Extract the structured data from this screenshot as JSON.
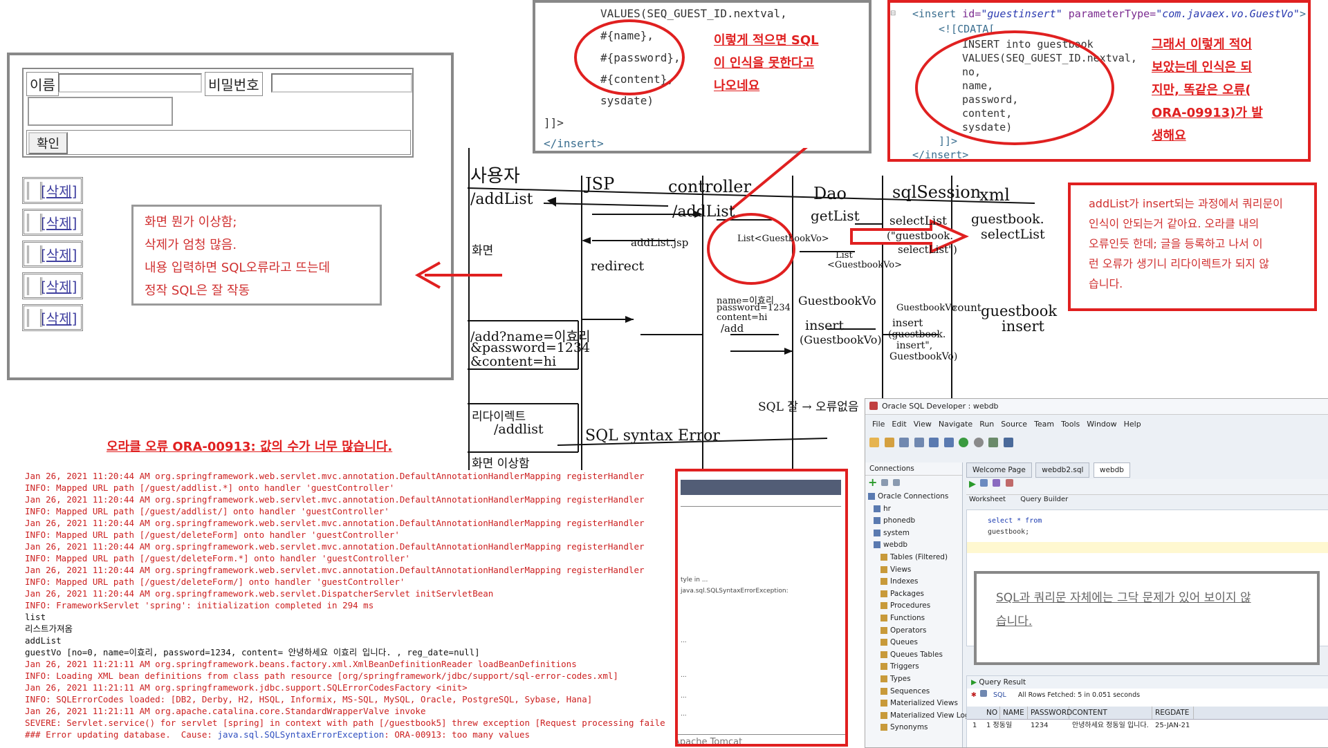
{
  "form": {
    "name_label": "이름",
    "password_label": "비밀번호",
    "confirm_label": "확인",
    "delete_label": "[삭제]"
  },
  "notes": {
    "screen_note": [
      "화면 뭔가 이상함;",
      "삭제가 엄청 많음.",
      "내용 입력하면 SQL오류라고 뜨는데",
      "정작 SQL은 잘 작동"
    ],
    "sql_note": [
      "이렇게 적으면 SQL",
      "이 인식을 못한다고",
      "나오네요"
    ],
    "sql_note2": [
      "그래서 이렇게 적어",
      "보았는데 인식은 되",
      "지만, 똑같은 오류(",
      "ORA-09913)가 발",
      "생해요"
    ],
    "addlist_note": [
      "addList가 insert되는 과정에서 쿼리문이",
      "인식이 안되는거 같아요. 오라클 내의",
      "오류인듯 한데; 글을 등록하고 나서 이",
      "런 오류가 생기니 리다이렉트가 되지 않",
      "습니다."
    ],
    "oracle_error_title": "오라클 오류 ORA-00913: 값의 수가 너무 많습니다.",
    "query_ok_note": [
      "SQL과 쿼리문 자체에는 그닥 문제가 있어 보이지 않",
      "습니다."
    ]
  },
  "code1": {
    "lines": [
      "VALUES(SEQ_GUEST_ID.nextval,",
      "#{name},",
      "#{password},",
      "#{content},",
      "sysdate)",
      "]]>",
      "</insert>"
    ]
  },
  "code2": {
    "insert_open": "<insert",
    "id_attr": "id=",
    "id_val": "\"guestinsert\"",
    "param_attr": "parameterType=",
    "param_val": "\"com.javaex.vo.GuestVo\"",
    "insert_close_bracket": ">",
    "cdata": "<![CDATA[",
    "body": [
      "INSERT into guestbook",
      "VALUES(SEQ_GUEST_ID.nextval,",
      "no,",
      "name,",
      "password,",
      "content,",
      "sysdate)"
    ],
    "cdata_end": "]]>",
    "insert_end": "</insert>"
  },
  "sketch": {
    "actors": [
      "사용자",
      "JSP",
      "controller",
      "Dao",
      "sqlSession",
      "xml"
    ],
    "labels": {
      "addlist1": "/addList",
      "addlist2": "/addList",
      "getlist": "getList",
      "selectlist": "selectList",
      "guestbook_select": "guestbook.",
      "guestbook_select2": "selectList",
      "selectlist_q1": "(\"guestbook.",
      "selectlist_q2": "selectList\")",
      "list_vo": "List<GuestbookVo>",
      "list_vo2": "List",
      "list_vo3": "<GuestbookVo>",
      "addlist_jsp": "addList.jsp",
      "screen": "화면",
      "redirect": "redirect",
      "params": "name=이효리",
      "params2": "password=1234",
      "params3": "content=hi",
      "params4": "/add",
      "guestbookvo": "GuestbookVo",
      "insert": "insert",
      "insert_vo": "(GuestbookVo)",
      "insert2": "insert",
      "insert3": "(guestbook.",
      "insert4": "insert\",",
      "insert5": "GuestbookVo)",
      "guestbookvo2": "GuestbookVo",
      "count": "count",
      "guestbook_insert": "guestbook",
      "guestbook_insert2": "insert",
      "add_url1": "/add?name=이효리",
      "add_url2": "&password=1234",
      "add_url3": "&content=hi",
      "redirect_ko": "리다이렉트",
      "addlist3": "/addlist",
      "syntax": "SQL syntax Error",
      "sql_ok": "SQL 잘 → 오류없음",
      "screen_weird": "화면 이상함"
    }
  },
  "log": {
    "lines": [
      {
        "t": "Jan 26, 2021 11:20:44 AM org.springframework.web.servlet.mvc.annotation.DefaultAnnotationHandlerMapping registerHandler",
        "c": "r"
      },
      {
        "t": "INFO: Mapped URL path [/guest/addlist.*] onto handler 'guestController'",
        "c": "r"
      },
      {
        "t": "Jan 26, 2021 11:20:44 AM org.springframework.web.servlet.mvc.annotation.DefaultAnnotationHandlerMapping registerHandler",
        "c": "r"
      },
      {
        "t": "INFO: Mapped URL path [/guest/addlist/] onto handler 'guestController'",
        "c": "r"
      },
      {
        "t": "Jan 26, 2021 11:20:44 AM org.springframework.web.servlet.mvc.annotation.DefaultAnnotationHandlerMapping registerHandler",
        "c": "r"
      },
      {
        "t": "INFO: Mapped URL path [/guest/deleteForm] onto handler 'guestController'",
        "c": "r"
      },
      {
        "t": "Jan 26, 2021 11:20:44 AM org.springframework.web.servlet.mvc.annotation.DefaultAnnotationHandlerMapping registerHandler",
        "c": "r"
      },
      {
        "t": "INFO: Mapped URL path [/guest/deleteForm.*] onto handler 'guestController'",
        "c": "r"
      },
      {
        "t": "Jan 26, 2021 11:20:44 AM org.springframework.web.servlet.mvc.annotation.DefaultAnnotationHandlerMapping registerHandler",
        "c": "r"
      },
      {
        "t": "INFO: Mapped URL path [/guest/deleteForm/] onto handler 'guestController'",
        "c": "r"
      },
      {
        "t": "Jan 26, 2021 11:20:44 AM org.springframework.web.servlet.DispatcherServlet initServletBean",
        "c": "r"
      },
      {
        "t": "INFO: FrameworkServlet 'spring': initialization completed in 294 ms",
        "c": "r"
      },
      {
        "t": "list",
        "c": "k"
      },
      {
        "t": "리스트가져옴",
        "c": "k"
      },
      {
        "t": "addList",
        "c": "k"
      },
      {
        "t": "guestVo [no=0, name=이효리, password=1234, content= 안녕하세요 이효리 입니다. , reg_date=null]",
        "c": "k"
      },
      {
        "t": "Jan 26, 2021 11:21:11 AM org.springframework.beans.factory.xml.XmlBeanDefinitionReader loadBeanDefinitions",
        "c": "r"
      },
      {
        "t": "INFO: Loading XML bean definitions from class path resource [org/springframework/jdbc/support/sql-error-codes.xml]",
        "c": "r"
      },
      {
        "t": "Jan 26, 2021 11:21:11 AM org.springframework.jdbc.support.SQLErrorCodesFactory <init>",
        "c": "r"
      },
      {
        "t": "INFO: SQLErrorCodes loaded: [DB2, Derby, H2, HSQL, Informix, MS-SQL, MySQL, Oracle, PostgreSQL, Sybase, Hana]",
        "c": "r"
      },
      {
        "t": "Jan 26, 2021 11:21:11 AM org.apache.catalina.core.StandardWrapperValve invoke",
        "c": "r"
      },
      {
        "t": "SEVERE: Servlet.service() for servlet [spring] in context with path [/guestbook5] threw exception [Request processing faile",
        "c": "r"
      },
      {
        "t": "### Error updating database.  Cause: ",
        "c": "r",
        "link": "java.sql.SQLSyntaxErrorException",
        "rest": ": ORA-00913: too many values"
      }
    ]
  },
  "sqldev": {
    "title": "Oracle SQL Developer : webdb",
    "menu": [
      "File",
      "Edit",
      "View",
      "Navigate",
      "Run",
      "Source",
      "Team",
      "Tools",
      "Window",
      "Help"
    ],
    "connections_label": "Connections",
    "tree": [
      "Oracle Connections",
      "hr",
      "phonedb",
      "system",
      "webdb",
      "Tables (Filtered)",
      "Views",
      "Indexes",
      "Packages",
      "Procedures",
      "Functions",
      "Operators",
      "Queues",
      "Queues Tables",
      "Triggers",
      "Types",
      "Sequences",
      "Materialized Views",
      "Materialized View Logs",
      "Synonyms"
    ],
    "tabs": [
      "Welcome Page",
      "webdb2.sql",
      "webdb"
    ],
    "sub_tabs": [
      "Worksheet",
      "Query Builder"
    ],
    "query": [
      "select * from",
      "guestbook;"
    ],
    "result_tab": "Query Result",
    "fetch_info": "All Rows Fetched: 5 in 0.051 seconds",
    "result_sql": "SQL",
    "columns": [
      "NO",
      "NAME",
      "PASSWORD",
      "CONTENT",
      "REGDATE"
    ],
    "row": [
      "1",
      "1 정동일",
      "1234",
      "안녕하세요 정동일 입니다.",
      "25-JAN-21"
    ]
  },
  "browser2": {
    "lines": [
      "",
      "tyle in ...",
      "java.sql.SQLSyntaxErrorException:",
      "...",
      "...",
      "...",
      "..."
    ],
    "footer": "Apache Tomcat"
  },
  "colors": {
    "accent_red": "#e02020",
    "note_red": "#d03030"
  }
}
